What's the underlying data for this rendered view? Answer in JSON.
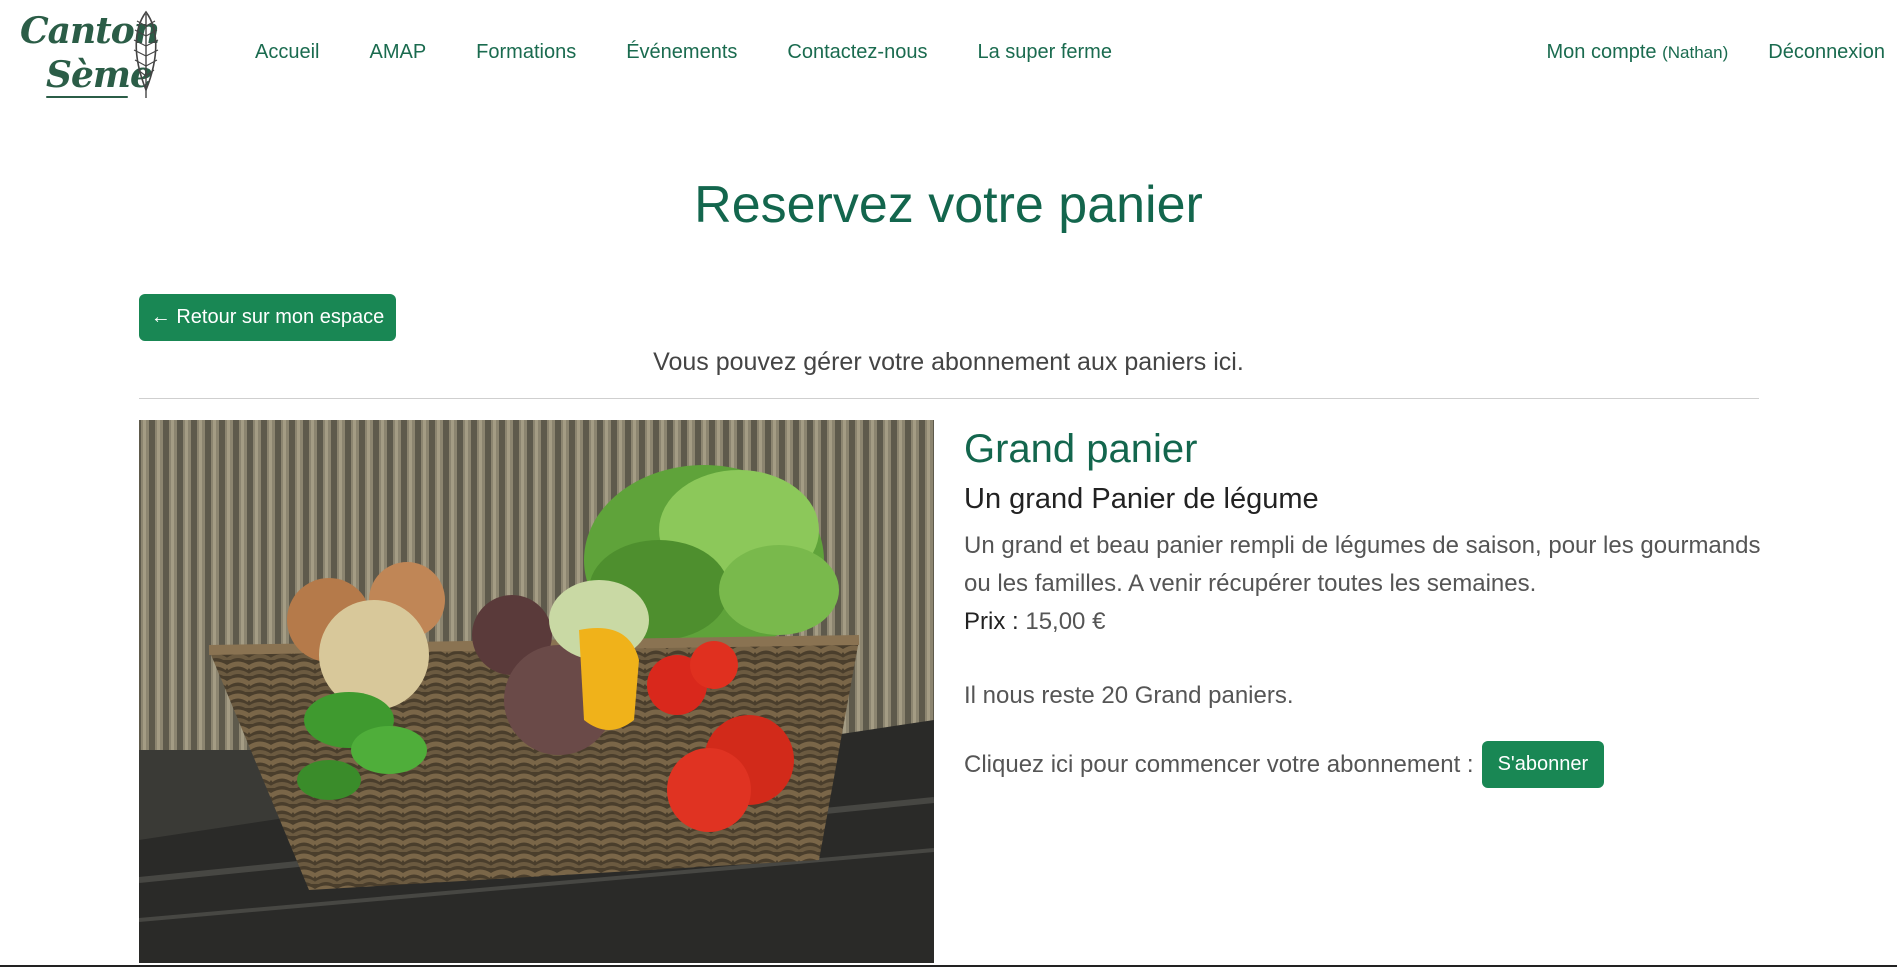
{
  "brand": {
    "line1": "Canton",
    "line2": "Sème",
    "leaf_icon": "leaf-icon"
  },
  "nav": {
    "items": [
      {
        "label": "Accueil"
      },
      {
        "label": "AMAP"
      },
      {
        "label": "Formations"
      },
      {
        "label": "Événements"
      },
      {
        "label": "Contactez-nous"
      },
      {
        "label": "La super ferme"
      }
    ]
  },
  "account": {
    "label": "Mon compte",
    "user": "(Nathan)",
    "logout": "Déconnexion"
  },
  "page": {
    "title": "Reservez votre panier",
    "back_button": "← Retour sur mon espace",
    "intro": "Vous pouvez gérer votre abonnement aux paniers ici."
  },
  "basket": {
    "name": "Grand panier",
    "subtitle": "Un grand Panier de légume",
    "description": "Un grand et beau panier rempli de légumes de saison, pour les gourmands ou les familles. A venir récupérer toutes les semaines.",
    "price_label": "Prix :",
    "price_value": "15,00 €",
    "stock_text": "Il nous reste 20 Grand paniers.",
    "cta_text": "Cliquez ici pour commencer votre abonnement :",
    "subscribe_button": "S'abonner"
  },
  "colors": {
    "brand_green": "#13664d",
    "button_green": "#198754"
  }
}
